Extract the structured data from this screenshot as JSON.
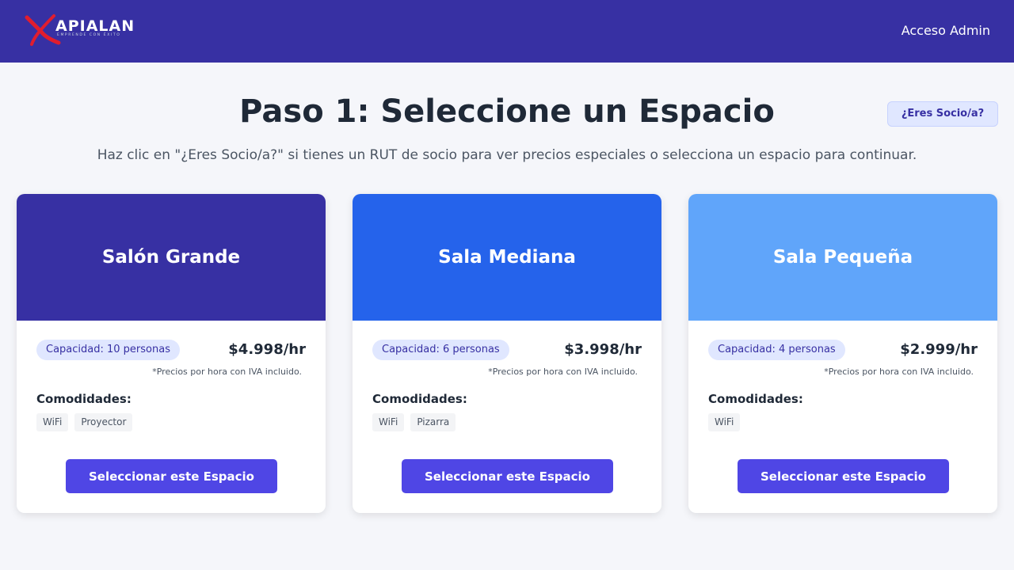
{
  "header": {
    "logo_text": "APIALAN",
    "logo_tagline": "EMPRENDE CON ÉXITO",
    "admin_link": "Acceso Admin"
  },
  "main": {
    "title": "Paso 1: Seleccione un Espacio",
    "socio_button": "¿Eres Socio/a?",
    "subtitle": "Haz clic en \"¿Eres Socio/a?\" si tienes un RUT de socio para ver precios especiales o selecciona un espacio para continuar."
  },
  "colors": {
    "header_bg": "#3730a3",
    "card1_header": "#3730a3",
    "card2_header": "#2563eb",
    "card3_header": "#60a5fa",
    "button": "#4f46e5",
    "logo_accent": "#e11d2e"
  },
  "spaces": [
    {
      "name": "Salón Grande",
      "capacity": "Capacidad: 10 personas",
      "price": "$4.998/hr",
      "price_note": "*Precios por hora con IVA incluido.",
      "amenities_title": "Comodidades:",
      "amenities": [
        "WiFi",
        "Proyector"
      ],
      "button": "Seleccionar este Espacio"
    },
    {
      "name": "Sala Mediana",
      "capacity": "Capacidad: 6 personas",
      "price": "$3.998/hr",
      "price_note": "*Precios por hora con IVA incluido.",
      "amenities_title": "Comodidades:",
      "amenities": [
        "WiFi",
        "Pizarra"
      ],
      "button": "Seleccionar este Espacio"
    },
    {
      "name": "Sala Pequeña",
      "capacity": "Capacidad: 4 personas",
      "price": "$2.999/hr",
      "price_note": "*Precios por hora con IVA incluido.",
      "amenities_title": "Comodidades:",
      "amenities": [
        "WiFi"
      ],
      "button": "Seleccionar este Espacio"
    }
  ]
}
